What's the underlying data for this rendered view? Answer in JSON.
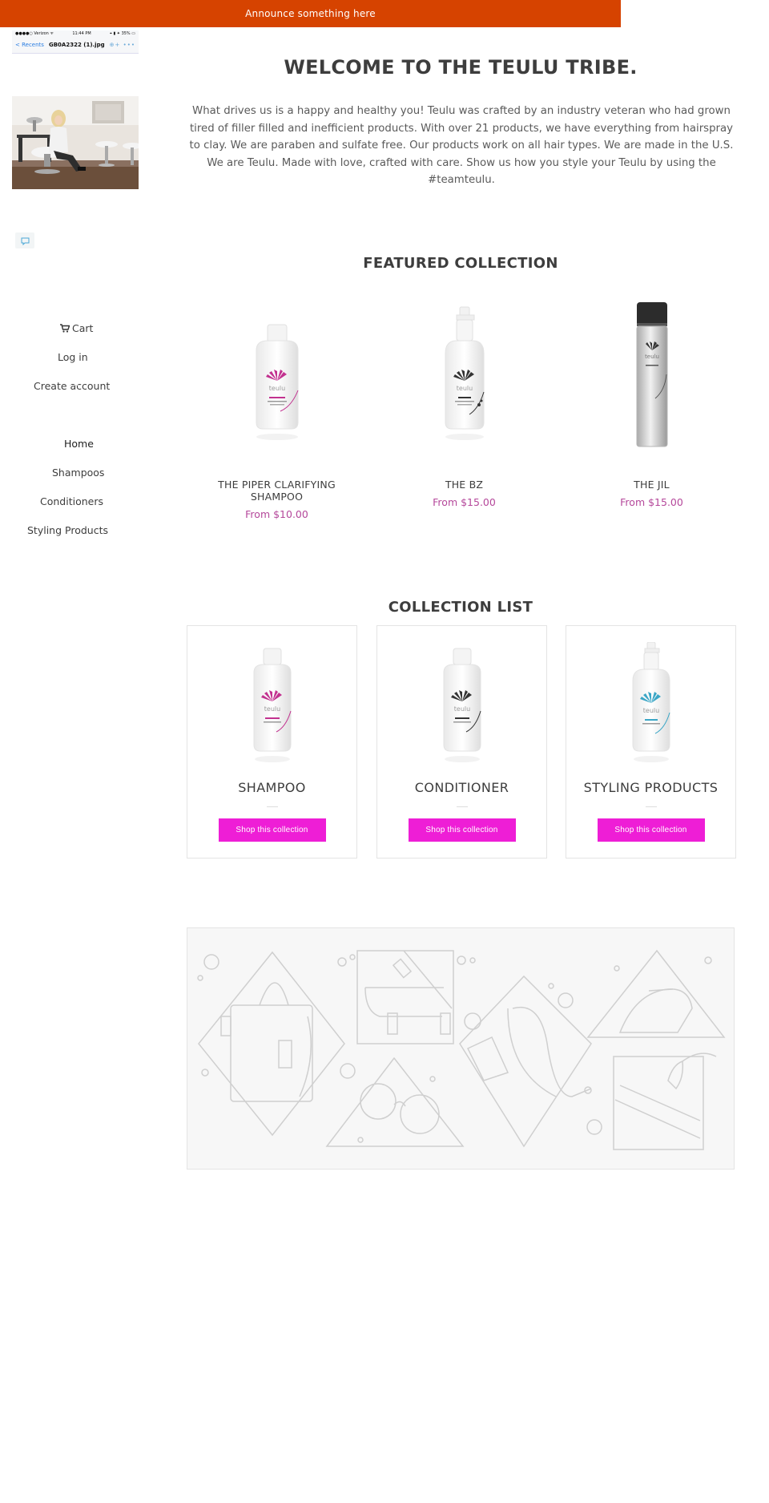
{
  "announcement": {
    "text": "Announce something here",
    "color": "#d64300"
  },
  "sidebar": {
    "phone_screenshot": {
      "carrier": "●●●●○ Verizon ᯤ",
      "time": "11:44 PM",
      "battery": "⌖ ▮ ✦ 35% ▭",
      "back": "< Recents",
      "filename": "GB0A2322 (1).jpg",
      "actions": "⊕+ •••"
    },
    "cart_label": "Cart",
    "login_label": "Log in",
    "create_account_label": "Create account",
    "nav": [
      {
        "label": "Home"
      },
      {
        "label": "Shampoos"
      },
      {
        "label": "Conditioners"
      },
      {
        "label": "Styling Products"
      }
    ]
  },
  "welcome": {
    "title": "WELCOME TO THE TEULU TRIBE.",
    "body": "What drives us is a happy and healthy you! Teulu was crafted by an industry veteran who had grown tired of filler filled and inefficient products. With over 21 products, we have everything from hairspray to clay. We are paraben and sulfate free. Our products work on all hair types. We are made in the U.S. We are Teulu. Made with love, crafted with care. Show us how you style your Teulu by using the #teamteulu."
  },
  "featured": {
    "title": "FEATURED COLLECTION",
    "products": [
      {
        "name": "THE PIPER CLARIFYING SHAMPOO",
        "price": "From $10.00",
        "accent": "#c2318f"
      },
      {
        "name": "THE BZ",
        "price": "From $15.00",
        "accent": "#333333"
      },
      {
        "name": "THE JIL",
        "price": "From $15.00",
        "accent": "#333333"
      }
    ]
  },
  "collections": {
    "title": "COLLECTION LIST",
    "items": [
      {
        "title": "SHAMPOO",
        "button": "Shop this collection",
        "accent": "#c2318f"
      },
      {
        "title": "CONDITIONER",
        "button": "Shop this collection",
        "accent": "#333333"
      },
      {
        "title": "STYLING PRODUCTS",
        "button": "Shop this collection",
        "accent": "#3aa6c6"
      }
    ],
    "button_color": "#ee1ed6"
  },
  "price_color": "#b5489b"
}
